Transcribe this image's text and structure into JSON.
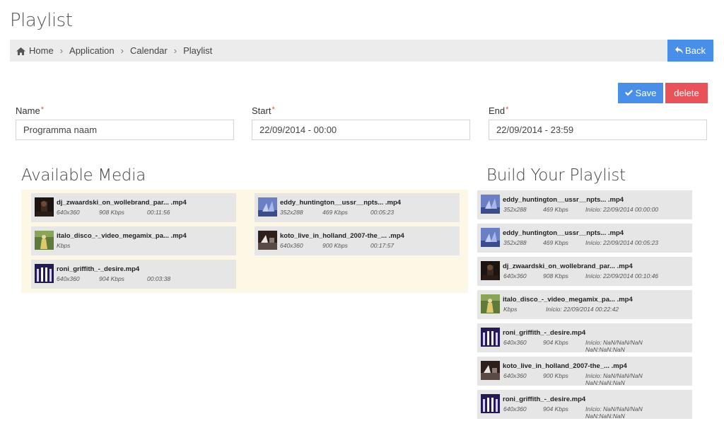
{
  "page": {
    "title": "Playlist"
  },
  "breadcrumb": {
    "items": [
      "Home",
      "Application",
      "Calendar",
      "Playlist"
    ]
  },
  "buttons": {
    "back": "Back",
    "save": "Save",
    "delete": "delete"
  },
  "form": {
    "name": {
      "label": "Name",
      "required": "*",
      "value": "Programma naam"
    },
    "start": {
      "label": "Start",
      "required": "*",
      "value": "22/09/2014 - 00:00"
    },
    "end": {
      "label": "End",
      "required": "*",
      "value": "22/09/2014 - 23:59"
    }
  },
  "available": {
    "title": "Available Media",
    "items": [
      {
        "name": "dj_zwaardski_on_wollebrand_par... .mp4",
        "res": "640x360",
        "bitrate": "908 Kbps",
        "duration": "00:11:56",
        "thumb": "dark-club"
      },
      {
        "name": "eddy_huntington__ussr__npts... .mp4",
        "res": "352x288",
        "bitrate": "469 Kbps",
        "duration": "00:05:23",
        "thumb": "blue-stage"
      },
      {
        "name": "italo_disco_-_video_megamix_pa... .mp4",
        "res": "",
        "bitrate": "Kbps",
        "duration": "",
        "thumb": "green-dancer"
      },
      {
        "name": "koto_live_in_holland_2007-the_... .mp4",
        "res": "640x360",
        "bitrate": "900 Kbps",
        "duration": "00:17:57",
        "thumb": "dark-stage"
      },
      {
        "name": "roni_griffith_-_desire.mp4",
        "res": "640x360",
        "bitrate": "904 Kbps",
        "duration": "00:03:38",
        "thumb": "purple-pillars"
      }
    ]
  },
  "playlist": {
    "title": "Build Your Playlist",
    "items": [
      {
        "name": "eddy_huntington__ussr__npts... .mp4",
        "res": "352x288",
        "bitrate": "469 Kbps",
        "start1": "Início: 22/09/2014 00:00:00",
        "start2": "",
        "thumb": "blue-stage"
      },
      {
        "name": "eddy_huntington__ussr__npts... .mp4",
        "res": "352x288",
        "bitrate": "469 Kbps",
        "start1": "Início: 22/09/2014 00:05:23",
        "start2": "",
        "thumb": "blue-stage"
      },
      {
        "name": "dj_zwaardski_on_wollebrand_par... .mp4",
        "res": "640x360",
        "bitrate": "908 Kbps",
        "start1": "Início: 22/09/2014 00:10:46",
        "start2": "",
        "thumb": "dark-club"
      },
      {
        "name": "italo_disco_-_video_megamix_pa... .mp4",
        "res": "",
        "bitrate": "Kbps",
        "start1": "Início: 22/09/2014 00:22:42",
        "start2": "",
        "thumb": "green-dancer"
      },
      {
        "name": "roni_griffith_-_desire.mp4",
        "res": "640x360",
        "bitrate": "904 Kbps",
        "start1": "Início: NaN/NaN/NaN",
        "start2": "NaN:NaN:NaN",
        "thumb": "purple-pillars"
      },
      {
        "name": "koto_live_in_holland_2007-the_... .mp4",
        "res": "640x360",
        "bitrate": "900 Kbps",
        "start1": "Início: NaN/NaN/NaN",
        "start2": "NaN:NaN:NaN",
        "thumb": "dark-stage"
      },
      {
        "name": "roni_griffith_-_desire.mp4",
        "res": "640x360",
        "bitrate": "904 Kbps",
        "start1": "Início: NaN/NaN/NaN",
        "start2": "NaN:NaN:NaN",
        "thumb": "purple-pillars"
      }
    ]
  },
  "icons": {
    "home": "home-icon",
    "back": "reply-arrow-icon",
    "save": "check-icon"
  },
  "colors": {
    "primary": "#4a8fe7",
    "danger": "#e8535a",
    "panel": "#fdf8e6",
    "card": "#e6e6e6",
    "breadcrumb_bg": "#ececec"
  }
}
